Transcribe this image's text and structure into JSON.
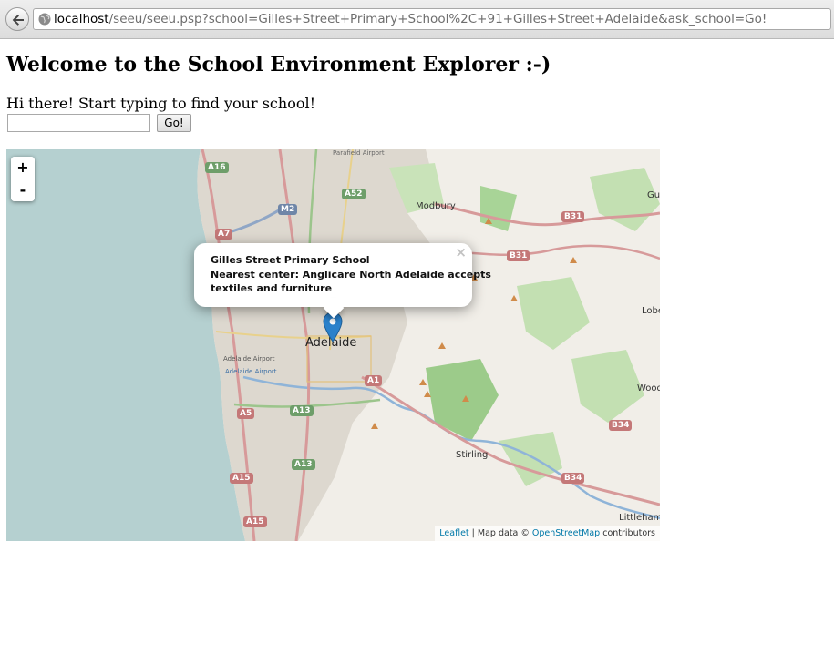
{
  "browser": {
    "url_host": "localhost",
    "url_path": "/seeu/seeu.psp?school=Gilles+Street+Primary+School%2C+91+Gilles+Street+Adelaide&ask_school=Go!"
  },
  "page": {
    "title": "Welcome to the School Environment Explorer :-)",
    "intro": "Hi there! Start typing to find your school!",
    "search": {
      "value": "",
      "placeholder": ""
    },
    "go_label": "Go!"
  },
  "map": {
    "zoom_in": "+",
    "zoom_out": "-",
    "popup": {
      "school": "Gilles Street Primary School",
      "nearest_line1": "Nearest center: Anglicare North Adelaide accepts",
      "nearest_line2": "textiles and furniture",
      "close": "×"
    },
    "place_labels": {
      "modbury": "Modbury",
      "adelaide": "Adelaide",
      "stirling": "Stirling",
      "littlehampton": "Littleham",
      "lobe": "Lobe",
      "wood": "Wood",
      "gu": "Gu",
      "parafield_airport": "Parafield Airport",
      "adelaide_airport": "Adelaide Airport",
      "adelaide_airport_2": "Adelaide Airport"
    },
    "road_shields": {
      "a16": "A16",
      "a52": "A52",
      "m2": "M2",
      "a7": "A7",
      "b31a": "B31",
      "b31b": "B31",
      "a1": "A1",
      "a5": "A5",
      "a13a": "A13",
      "a13b": "A13",
      "a15a": "A15",
      "a15b": "A15",
      "b34a": "B34",
      "b34b": "B34"
    },
    "attribution": {
      "leaflet": "Leaflet",
      "separator": " | Map data © ",
      "osm": "OpenStreetMap",
      "suffix": " contributors"
    },
    "colors": {
      "sea": "#b5d0d0",
      "urban": "#dcd7cf",
      "park": "#9fcf8c",
      "marker": "#2a81cb"
    }
  }
}
